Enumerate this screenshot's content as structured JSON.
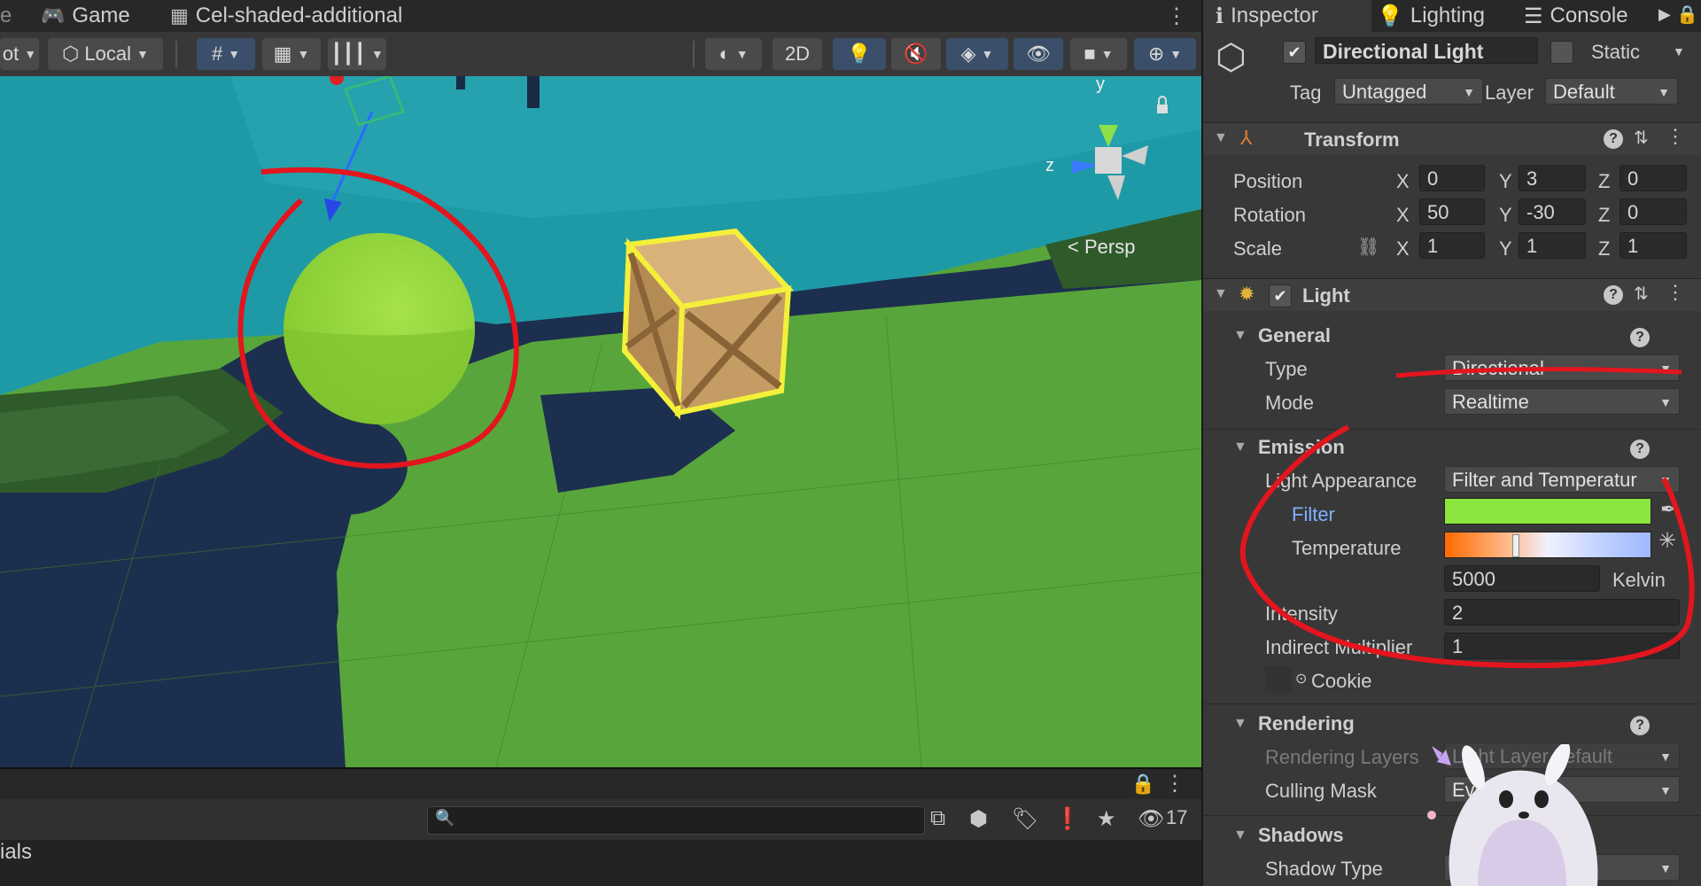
{
  "left_tabs": {
    "game": "Game",
    "scene": "Cel-shaded-additional",
    "kebab": "⋮",
    "cut_glyph": "e"
  },
  "toolbar": {
    "pivot": "ot",
    "local": "Local",
    "two_d": "2D"
  },
  "viewport": {
    "persp": "< Persp",
    "gizmo_y": "y",
    "gizmo_z": "z"
  },
  "project": {
    "label": "ials",
    "search_placeholder": "",
    "hidden_count": "17"
  },
  "inspector": {
    "tabs": {
      "inspector": "Inspector",
      "lighting": "Lighting",
      "console": "Console"
    },
    "object": {
      "enabled": true,
      "name": "Directional Light",
      "static_label": "Static",
      "tag_label": "Tag",
      "tag": "Untagged",
      "layer_label": "Layer",
      "layer": "Default"
    },
    "transform": {
      "title": "Transform",
      "position_label": "Position",
      "rotation_label": "Rotation",
      "scale_label": "Scale",
      "axes": {
        "x": "X",
        "y": "Y",
        "z": "Z"
      },
      "position": {
        "x": "0",
        "y": "3",
        "z": "0"
      },
      "rotation": {
        "x": "50",
        "y": "-30",
        "z": "0"
      },
      "scale": {
        "x": "1",
        "y": "1",
        "z": "1"
      }
    },
    "light": {
      "title": "Light",
      "general": "General",
      "type_label": "Type",
      "type": "Directional",
      "mode_label": "Mode",
      "mode": "Realtime",
      "emission": "Emission",
      "appearance_label": "Light Appearance",
      "appearance": "Filter and Temperatur",
      "filter_label": "Filter",
      "filter_color": "#8ae63c",
      "temperature_label": "Temperature",
      "kelvin": "5000",
      "kelvin_unit": "Kelvin",
      "intensity_label": "Intensity",
      "intensity": "2",
      "indirect_label": "Indirect Multiplier",
      "indirect": "1",
      "cookie_label": "Cookie",
      "rendering": "Rendering",
      "rendering_layers_label": "Rendering Layers",
      "rendering_layers": "Light Layer default",
      "culling_label": "Culling Mask",
      "culling": "Everyt",
      "shadows": "Shadows",
      "shadow_type_label": "Shadow Type",
      "shadow_type": "S"
    }
  },
  "colors": {
    "accent_blue": "#7fb0ff",
    "annotation_red": "#e3151e",
    "selection_yellow": "#f4f03a"
  }
}
